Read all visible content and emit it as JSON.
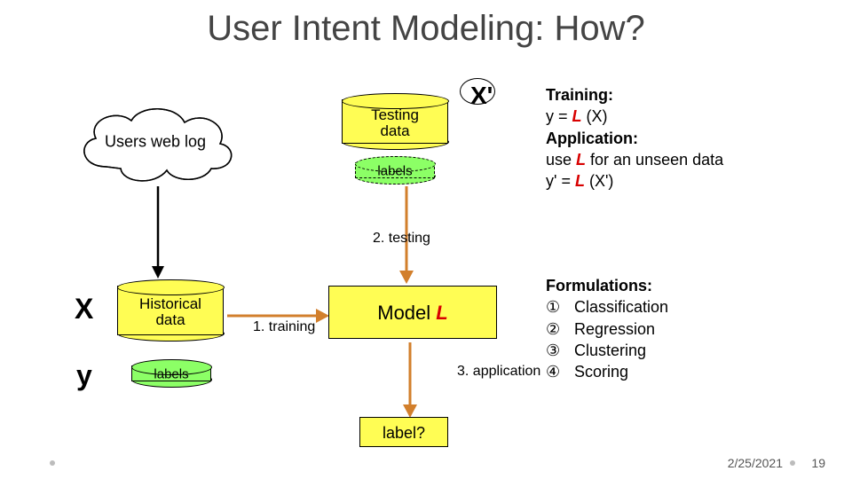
{
  "title": "User Intent Modeling: How?",
  "cloud_label": "Users web log",
  "testing_data": "Testing data",
  "labels_test": "labels",
  "historical_data": "Historical data",
  "labels_train": "labels",
  "model_l_prefix": "Model ",
  "model_l_sym": "L",
  "label_q": "label?",
  "var_x_prime": "X'",
  "var_x": "X",
  "var_y": "y",
  "flow": {
    "training": "1. training",
    "testing": "2. testing",
    "application": "3. application"
  },
  "training_block": {
    "h1": "Training:",
    "line1a": "y = ",
    "line1b": "L",
    "line1c": " (X)",
    "h2": "Application:",
    "line2a": "use ",
    "line2b": "L",
    "line2c": " for an unseen data",
    "line3a": "y' = ",
    "line3b": "L",
    "line3c": " (X')"
  },
  "formulations": {
    "title": "Formulations:",
    "items": [
      "Classification",
      "Regression",
      "Clustering",
      "Scoring"
    ],
    "bullets": [
      "①",
      "②",
      "③",
      "④"
    ]
  },
  "footer": {
    "date": "2/25/2021",
    "page": "19"
  }
}
